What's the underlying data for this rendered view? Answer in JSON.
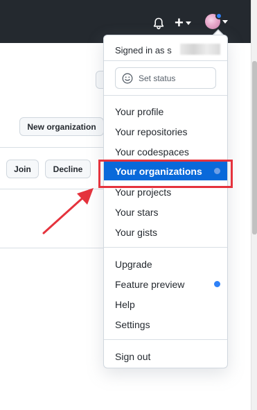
{
  "header": {
    "bell_icon": "bell-icon",
    "create_icon": "plus-icon",
    "avatar_icon": "avatar",
    "colors": {
      "background": "#24292f",
      "notification_dot": "#2f81f7"
    }
  },
  "background": {
    "new_org_label": "New organization",
    "join_label": "Join",
    "decline_label": "Decline"
  },
  "dropdown": {
    "signed_in_label": "Signed in as",
    "signed_in_user_visible": "s",
    "set_status_label": "Set status",
    "items": [
      {
        "label": "Your profile"
      },
      {
        "label": "Your repositories"
      },
      {
        "label": "Your codespaces"
      },
      {
        "label": "Your organizations",
        "highlighted": true,
        "dot": true
      },
      {
        "label": "Your projects"
      },
      {
        "label": "Your stars"
      },
      {
        "label": "Your gists"
      },
      {
        "label": "Upgrade"
      },
      {
        "label": "Feature preview",
        "dot": true
      },
      {
        "label": "Help"
      },
      {
        "label": "Settings"
      },
      {
        "label": "Sign out"
      }
    ],
    "colors": {
      "highlight": "#0969da",
      "dot": "#2f81f7"
    }
  },
  "annotations": {
    "highlight_box_color": "#e5333d",
    "arrow_color": "#e5333d"
  }
}
